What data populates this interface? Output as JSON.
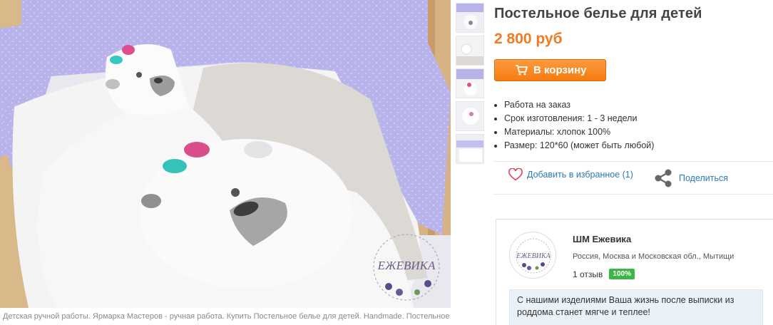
{
  "caption": "Детская ручной работы. Ярмарка Мастеров - ручная работа. Купить Постельное белье для детей. Handmade. Постельное",
  "watermark": "ЕЖЕВИКА",
  "product": {
    "title": "Постельное белье для детей",
    "price": "2 800 руб",
    "cart_label": "В корзину",
    "features": [
      "Работа на заказ",
      "Срок изготовления: 1 - 3 недели",
      "Материалы:  хлопок 100%",
      "Размер: 120*60 (может быть любой)"
    ]
  },
  "actions": {
    "favorite": "Добавить в избранное (1)",
    "share": "Поделиться"
  },
  "shop": {
    "name": "ШМ Ежевика",
    "location": "Россия, Москва и Московская обл., Мытищи",
    "reviews": "1 отзыв",
    "rating": "100%",
    "logo_text": "ЕЖЕВИКА",
    "quote": "С нашими изделиями Ваша жизнь после выписки из роддома станет мягче и теплее!"
  },
  "colors": {
    "accent": "#f47a1f",
    "link": "#2a7ab8",
    "badge": "#3fb548",
    "lavender": "#b3aee6"
  },
  "icons": {
    "cart": "cart-icon",
    "favorite": "heart-icon",
    "share": "share-icon"
  }
}
